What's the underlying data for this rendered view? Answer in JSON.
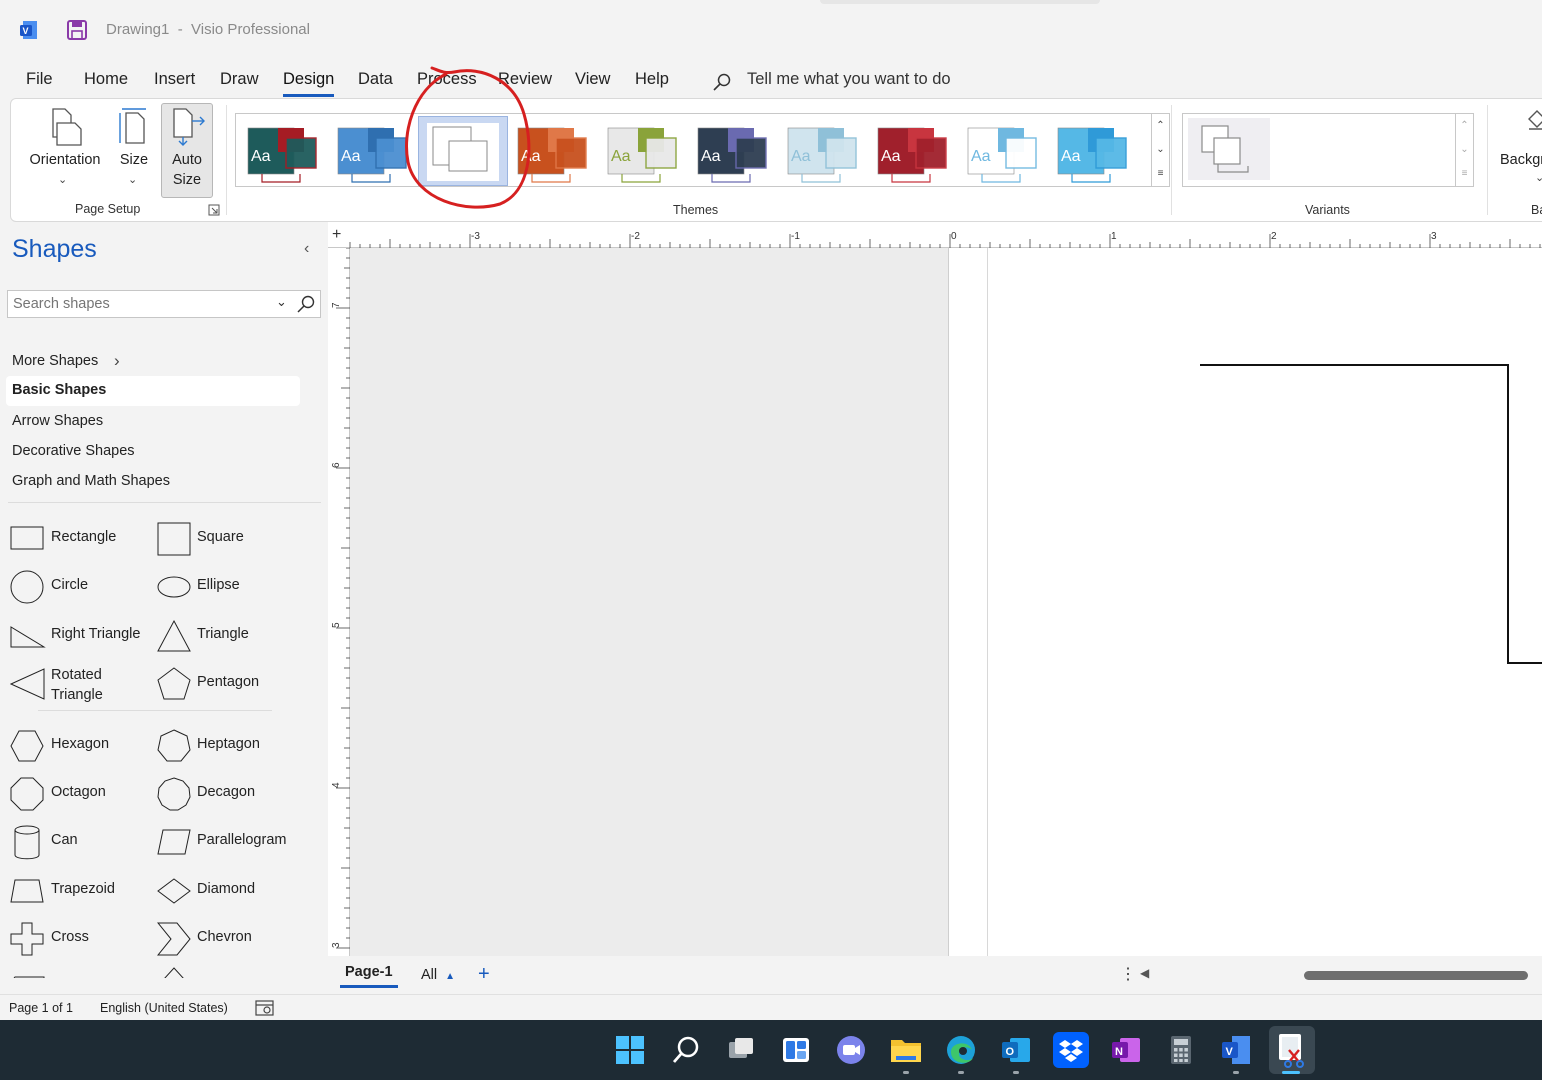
{
  "window": {
    "title": "Drawing1  -  Visio Professional"
  },
  "menu": {
    "tabs": [
      "File",
      "Home",
      "Insert",
      "Draw",
      "Design",
      "Data",
      "Process",
      "Review",
      "View",
      "Help"
    ],
    "active_tab": "Design",
    "tell_me": "Tell me what you want to do"
  },
  "ribbon": {
    "page_setup": {
      "orientation_label": "Orientation",
      "size_label": "Size",
      "auto_size_line1": "Auto",
      "auto_size_line2": "Size",
      "group_label": "Page Setup"
    },
    "themes": {
      "group_label": "Themes",
      "items": [
        {
          "name": "Aa",
          "primary": "#1e5b5b",
          "secondary": "#a51c24"
        },
        {
          "name": "Aa",
          "primary": "#4b8fd1",
          "secondary": "#2f6fb0"
        },
        {
          "name": "",
          "primary": "#ffffff",
          "secondary": "#ffffff"
        },
        {
          "name": "Aa",
          "primary": "#c8511e",
          "secondary": "#e07848"
        },
        {
          "name": "Aa",
          "primary": "#e8e8e8",
          "secondary": "#8aa33a"
        },
        {
          "name": "Aa",
          "primary": "#2e3e52",
          "secondary": "#6a6ab0"
        },
        {
          "name": "Aa",
          "primary": "#d0e4ee",
          "secondary": "#8fc0d8"
        },
        {
          "name": "Aa",
          "primary": "#a0202c",
          "secondary": "#c8353f"
        },
        {
          "name": "Aa",
          "primary": "#ffffff",
          "secondary": "#6fb8e0"
        },
        {
          "name": "Aa",
          "primary": "#55b8e6",
          "secondary": "#2f9ad8"
        }
      ],
      "annotation_color": "#d62020"
    },
    "variants": {
      "group_label": "Variants"
    },
    "background": {
      "label": "Backgr"
    },
    "cut_label": "Ba"
  },
  "shapes_pane": {
    "title": "Shapes",
    "search_placeholder": "Search shapes",
    "stencils": [
      "More Shapes",
      "Basic Shapes",
      "Arrow Shapes",
      "Decorative Shapes",
      "Graph and Math Shapes"
    ],
    "selected_stencil": "Basic Shapes",
    "shapes": [
      {
        "label": "Rectangle",
        "icon": "rectangle-icon"
      },
      {
        "label": "Square",
        "icon": "square-icon"
      },
      {
        "label": "Circle",
        "icon": "circle-icon"
      },
      {
        "label": "Ellipse",
        "icon": "ellipse-icon"
      },
      {
        "label": "Right Triangle",
        "icon": "right-triangle-icon"
      },
      {
        "label": "Triangle",
        "icon": "triangle-icon"
      },
      {
        "label": "Rotated Triangle",
        "icon": "rotated-triangle-icon"
      },
      {
        "label": "Pentagon",
        "icon": "pentagon-icon"
      },
      {
        "label": "Hexagon",
        "icon": "hexagon-icon"
      },
      {
        "label": "Heptagon",
        "icon": "heptagon-icon"
      },
      {
        "label": "Octagon",
        "icon": "octagon-icon"
      },
      {
        "label": "Decagon",
        "icon": "decagon-icon"
      },
      {
        "label": "Can",
        "icon": "can-icon"
      },
      {
        "label": "Parallelogram",
        "icon": "parallelogram-icon"
      },
      {
        "label": "Trapezoid",
        "icon": "trapezoid-icon"
      },
      {
        "label": "Diamond",
        "icon": "diamond-icon"
      },
      {
        "label": "Cross",
        "icon": "cross-icon"
      },
      {
        "label": "Chevron",
        "icon": "chevron-icon"
      }
    ]
  },
  "rulers": {
    "horizontal": [
      "-3",
      "-2",
      "-1",
      "0",
      "1",
      "2",
      "3"
    ],
    "vertical": [
      "7",
      "6",
      "5",
      "4",
      "3"
    ]
  },
  "page_tabs": {
    "current": "Page-1",
    "all_label": "All"
  },
  "status": {
    "page": "Page 1 of 1",
    "language": "English (United States)"
  },
  "taskbar": {
    "apps": [
      "Start",
      "Search",
      "Task View",
      "Widgets",
      "Teams Chat",
      "File Explorer",
      "Edge",
      "Outlook",
      "Dropbox",
      "OneNote",
      "Calculator",
      "Visio",
      "Snipping Tool"
    ]
  }
}
